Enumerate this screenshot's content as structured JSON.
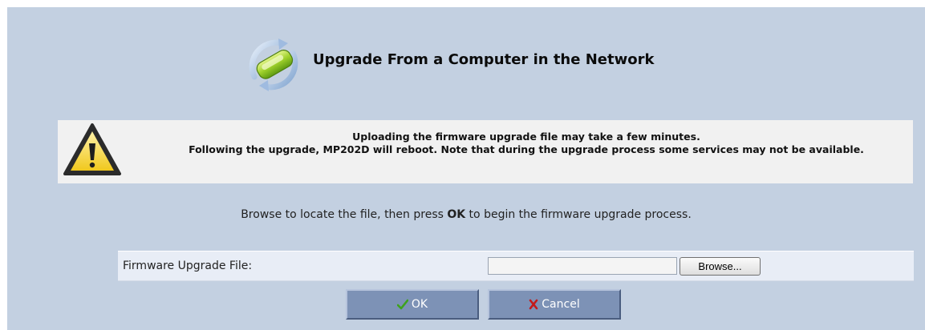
{
  "header": {
    "title": "Upgrade From a Computer in the Network",
    "icon": "firmware-upgrade-icon"
  },
  "warning": {
    "icon": "warning-icon",
    "line1": "Uploading the firmware upgrade file may take a few minutes.",
    "line2": "Following the upgrade, MP202D will reboot. Note that during the upgrade process some services may not be available."
  },
  "instructions": {
    "before": "Browse to locate the file, then press ",
    "emphasis": "OK",
    "after": " to begin the firmware upgrade process."
  },
  "file_field": {
    "label": "Firmware Upgrade File:",
    "value": "",
    "browse_label": "Browse..."
  },
  "buttons": {
    "ok_label": "OK",
    "ok_icon": "checkmark-icon",
    "cancel_label": "Cancel",
    "cancel_icon": "x-icon"
  },
  "colors": {
    "panel_bg": "#c3d0e1",
    "button_bg": "#7d92b6",
    "ok_check": "#3ea21d",
    "cancel_x": "#c41a1a"
  }
}
